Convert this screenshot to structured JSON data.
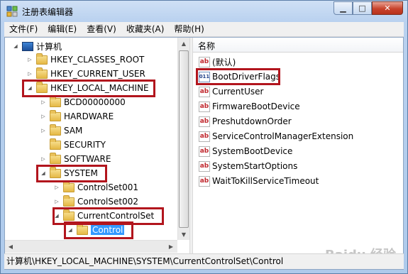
{
  "window": {
    "title": "注册表编辑器",
    "close_glyph": "✕",
    "min_glyph": "▁",
    "max_glyph": "□"
  },
  "menu": [
    "文件(F)",
    "编辑(E)",
    "查看(V)",
    "收藏夹(A)",
    "帮助(H)"
  ],
  "tree": {
    "root": "计算机",
    "nodes": [
      {
        "label": "HKEY_CLASSES_ROOT"
      },
      {
        "label": "HKEY_CURRENT_USER"
      },
      {
        "label": "HKEY_LOCAL_MACHINE"
      },
      {
        "label": "BCD00000000"
      },
      {
        "label": "HARDWARE"
      },
      {
        "label": "SAM"
      },
      {
        "label": "SECURITY"
      },
      {
        "label": "SOFTWARE"
      },
      {
        "label": "SYSTEM"
      },
      {
        "label": "ControlSet001"
      },
      {
        "label": "ControlSet002"
      },
      {
        "label": "CurrentControlSet"
      },
      {
        "label": "Control"
      }
    ]
  },
  "list": {
    "column_name": "名称",
    "values": [
      {
        "name": "(默认)",
        "icon": "string-value-icon"
      },
      {
        "name": "BootDriverFlags",
        "icon": "binary-value-icon"
      },
      {
        "name": "CurrentUser",
        "icon": "string-value-icon"
      },
      {
        "name": "FirmwareBootDevice",
        "icon": "string-value-icon"
      },
      {
        "name": "PreshutdownOrder",
        "icon": "string-value-icon"
      },
      {
        "name": "ServiceControlManagerExtension",
        "icon": "string-value-icon"
      },
      {
        "name": "SystemBootDevice",
        "icon": "string-value-icon"
      },
      {
        "name": "SystemStartOptions",
        "icon": "string-value-icon"
      },
      {
        "name": "WaitToKillServiceTimeout",
        "icon": "string-value-icon"
      }
    ],
    "icon_labels": {
      "string": "ab",
      "binary_top": "011",
      "binary_bottom": "110"
    }
  },
  "status": {
    "path": "计算机\\HKEY_LOCAL_MACHINE\\SYSTEM\\CurrentControlSet\\Control"
  },
  "watermark": "Baidu 经验",
  "colors": {
    "highlight": "#b2151d",
    "selection": "#3399ff"
  }
}
